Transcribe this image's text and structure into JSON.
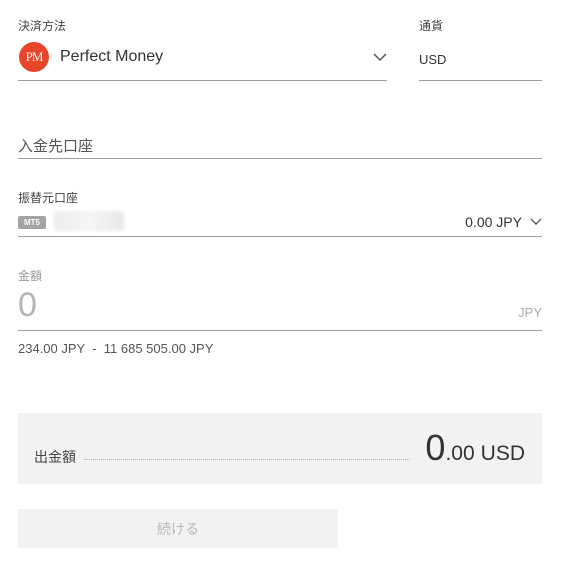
{
  "payment_method": {
    "label": "決済方法",
    "logo_text": "PM",
    "value": "Perfect Money",
    "logo_color": "#e8462a"
  },
  "currency": {
    "label": "通貨",
    "value": "USD"
  },
  "deposit_account": {
    "placeholder": "入金先口座"
  },
  "source_account": {
    "label": "振替元口座",
    "badge": "MT5",
    "balance": "0.00 JPY"
  },
  "amount": {
    "label": "金額",
    "value": "0",
    "unit": "JPY",
    "range": "234.00 JPY  -  11 685 505.00 JPY"
  },
  "withdrawal": {
    "label": "出金額",
    "amount_int": "0",
    "amount_dec": ".00",
    "currency": "USD"
  },
  "continue_button": {
    "label": "続ける"
  }
}
